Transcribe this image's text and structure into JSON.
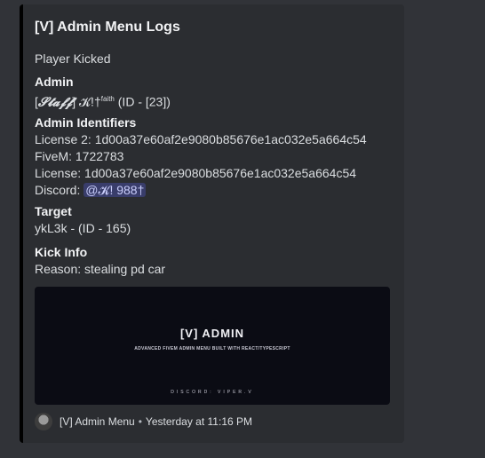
{
  "embed": {
    "title": "[V] Admin Menu Logs",
    "description": "Player Kicked",
    "accent_color": "#000000",
    "fields": {
      "admin": {
        "name": "Admin",
        "value_prefix": "[",
        "value_styled": "𝓢𝓽𝓪𝓯𝓯",
        "value_mid": "] 𝓚!",
        "value_dagger": "†",
        "value_sup": "faith",
        "value_suffix": " (ID - [23])"
      },
      "identifiers": {
        "name": "Admin Identifiers",
        "license2": "License 2: 1d00a37e60af2e9080b85676e1ac032e5a664c54",
        "fivem": "FiveM: 1722783",
        "license": "License: 1d00a37e60af2e9080b85676e1ac032e5a664c54",
        "discord_label": "Discord: ",
        "discord_mention": "@𝓚! 988†"
      },
      "target": {
        "name": "Target",
        "value": "ykL3k - (ID - 165)"
      },
      "kick_info": {
        "name": "Kick Info",
        "value": "Reason: stealing pd car"
      }
    },
    "banner": {
      "title": "[V] ADMIN",
      "subtitle": "ADVANCED FIVEM ADMIN MENU BUILT WITH REACT/TYPESCRIPT",
      "discord": "DISCORD: VIPER.V"
    },
    "footer": {
      "author": "[V] Admin Menu",
      "separator": "•",
      "timestamp": "Yesterday at 11:16 PM"
    }
  }
}
